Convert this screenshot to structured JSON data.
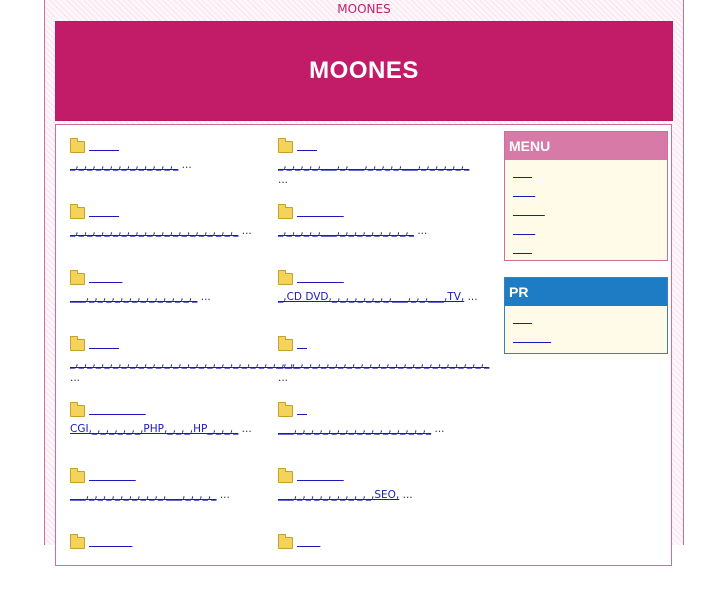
{
  "site": {
    "top_text": "MOONES",
    "banner_title": "MOONES"
  },
  "colors": {
    "brand": "#c21c69",
    "menu_head": "#d77aa8",
    "pr_head": "#1d7cc4",
    "link": "#1a1ab8"
  },
  "entries": [
    {
      "title": "         ",
      "desc": "_,_,_,_,_,_,_,_,_,_,_,_,_",
      "more": " ..."
    },
    {
      "title": "      ",
      "desc": "_,_,_,_,_,___,_,___,_,_,_,_,___,_,_,_,_,_,_",
      "more": " ..."
    },
    {
      "title": "         ",
      "desc": "_,_,_,_,_,_,_,_,_,_,_,_,_,_,_,_,_,_,_,_",
      "more": " ..."
    },
    {
      "title": "              ",
      "desc": "_,_,_,_,_,___,_,_,_,_,_,_,_,_,_",
      "more": " ..."
    },
    {
      "title": "          ",
      "desc": "___,_,_,_,_,_,_,_,_,_,_,_,_,_",
      "more": " ..."
    },
    {
      "title": "              ",
      "desc": "_,CD DVD,_,_,_,_,_,_,_,___,_,_,___,TV,",
      "more": " ..."
    },
    {
      "title": "         ",
      "desc": "_,_,_,_,_,_,_,_,_,_,_,_,_,_,_,_,_,_,_,_,_,_,_,_,_,_,_",
      "more": " ..."
    },
    {
      "title": "   ",
      "desc": "_,_,_,_,_,_,_,_,_,_,_,_,_,_,_,_,_,_,_,_,_,_,_,_,_",
      "more": " ..."
    },
    {
      "title": "                 ",
      "desc": "CGI,_,_,_,_,_,_,PHP,_,_,_,HP_,_,_,_",
      "more": " ..."
    },
    {
      "title": "   ",
      "desc": "___,_,_,_,_,_,_,_,_,_,_,_,_,_,_,_,_",
      "more": " ..."
    },
    {
      "title": "              ",
      "desc": "___,_,_,_,_,_,_,_,_,_,___,_,_,_,_",
      "more": " ..."
    },
    {
      "title": "              ",
      "desc": "___,_,_,_,_,_,_,_,_,_,SEO,",
      "more": " ..."
    },
    {
      "title": "             ",
      "desc": "",
      "more": ""
    },
    {
      "title": "       ",
      "desc": "",
      "more": ""
    }
  ],
  "menu": {
    "heading": "MENU",
    "items": [
      "      ",
      "       ",
      "          ",
      "       ",
      "      "
    ]
  },
  "pr": {
    "heading": "PR",
    "items": [
      "      ",
      "            "
    ]
  }
}
